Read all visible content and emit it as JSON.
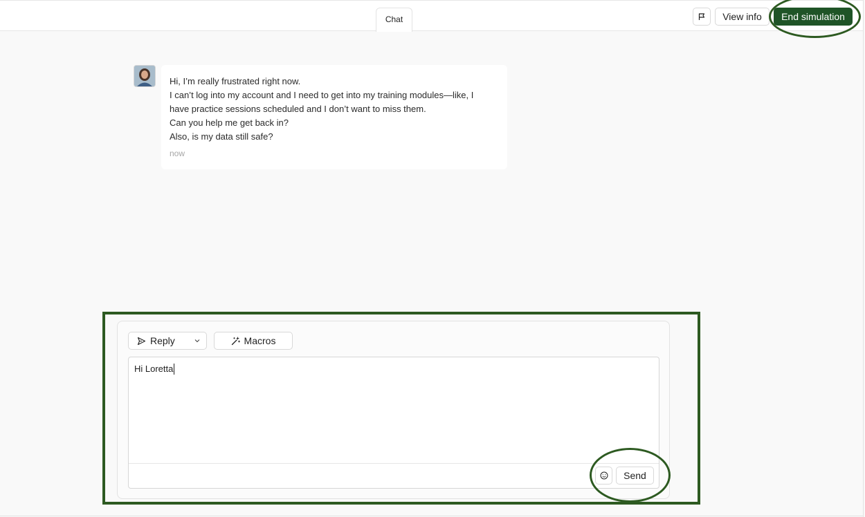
{
  "header": {
    "tab_label": "Chat",
    "flag_icon": "flag-icon",
    "view_info_label": "View info",
    "end_simulation_label": "End simulation",
    "accent_color": "#1f5427"
  },
  "chat": {
    "avatar_icon": "customer-avatar",
    "message_lines": [
      "Hi, I’m really frustrated right now.",
      "I can’t log into my account and I need to get into my training modules—like, I",
      "have practice sessions scheduled and I don’t want to miss them.",
      "Can you help me get back in?",
      "Also, is my data still safe?"
    ],
    "timestamp": "now"
  },
  "composer": {
    "reply_label": "Reply",
    "reply_icon": "send-arrow-icon",
    "macros_label": "Macros",
    "macros_icon": "magic-wand-icon",
    "editor_value": "Hi Loretta",
    "emoji_icon": "smiley-icon",
    "send_label": "Send"
  },
  "annotation_color": "#2d5a21"
}
